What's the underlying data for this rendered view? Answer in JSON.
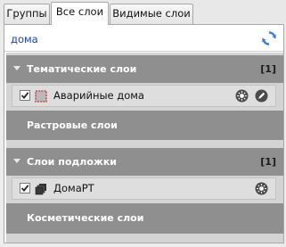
{
  "tabs": [
    {
      "label": "Группы"
    },
    {
      "label": "Все слои"
    },
    {
      "label": "Видимые слои"
    }
  ],
  "active_tab": "Все слои",
  "search": {
    "value": "дома"
  },
  "groups": {
    "thematic": {
      "title": "Тематические слои",
      "count": "[1]",
      "expanded": true
    },
    "raster": {
      "title": "Растровые слои"
    },
    "base": {
      "title": "Слои подложки",
      "count": "[1]",
      "expanded": true
    },
    "cosmetic": {
      "title": "Косметические слои"
    }
  },
  "layers": {
    "emergency": {
      "name": "Аварийные дома",
      "checked": true
    },
    "domart": {
      "name": "ДомаРТ",
      "checked": true
    }
  },
  "colors": {
    "group_header": "#8f8f8f",
    "search_text": "#1c47a6",
    "layer_row": "#dedede"
  }
}
